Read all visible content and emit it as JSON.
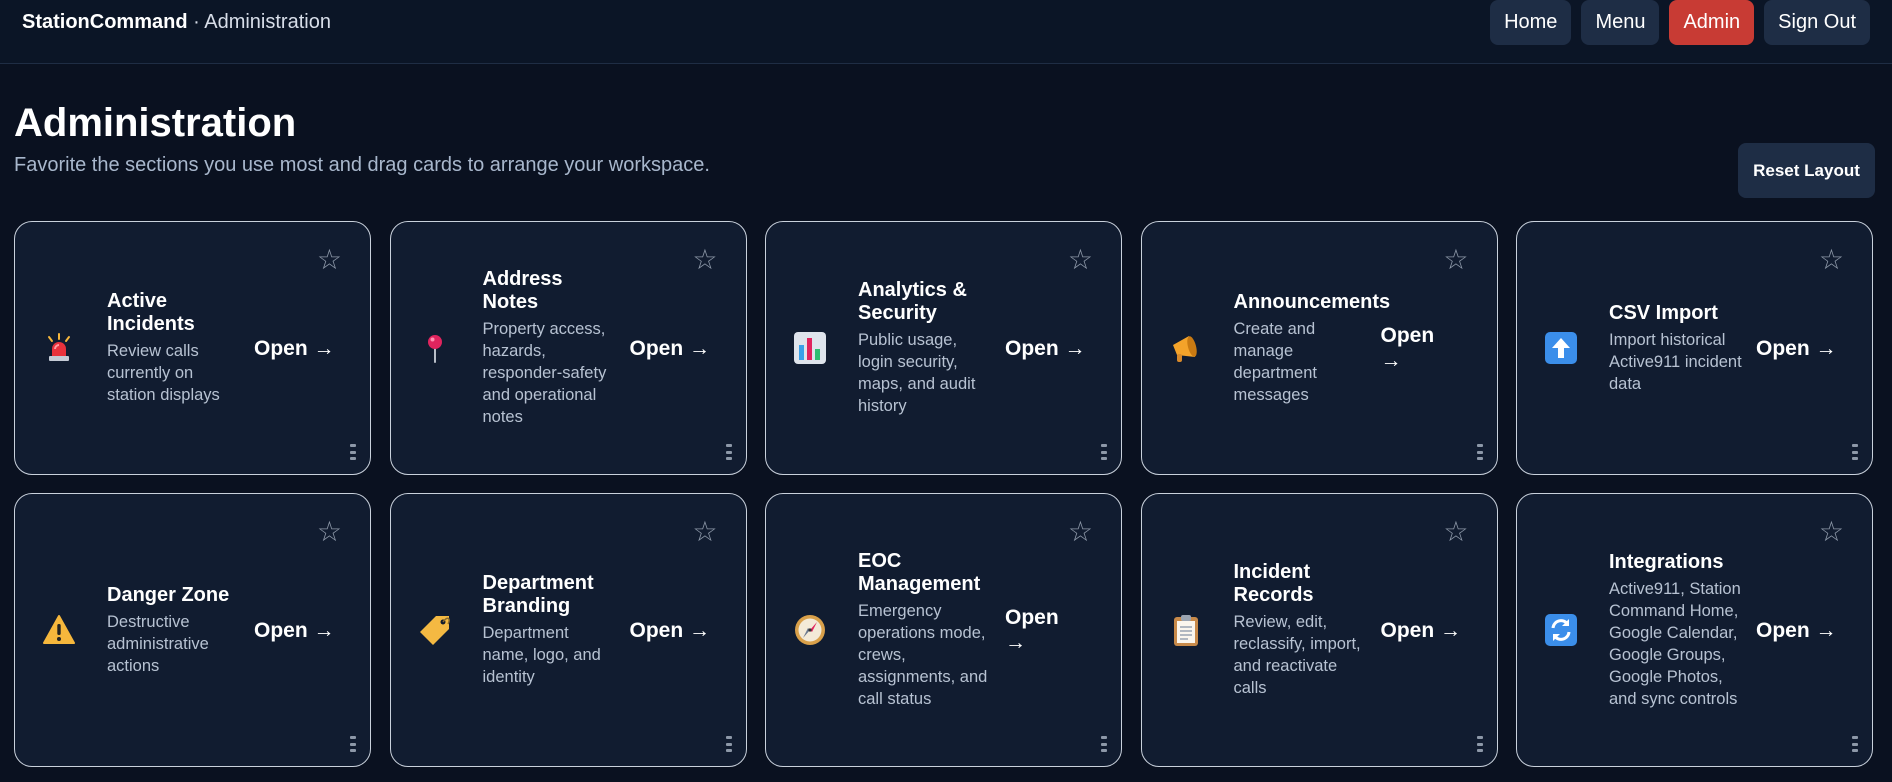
{
  "header": {
    "brand": "StationCommand",
    "section": " · Administration",
    "nav": [
      "Home",
      "Menu",
      "Admin",
      "Sign Out"
    ],
    "active_nav": "Admin"
  },
  "page": {
    "title": "Administration",
    "subtitle": "Favorite the sections you use most and drag cards to arrange your workspace.",
    "reset_label": "Reset Layout"
  },
  "cards": [
    {
      "title": "Active Incidents",
      "desc": "Review calls currently on station displays",
      "open": "Open →",
      "icon": "siren-icon"
    },
    {
      "title": "Address Notes",
      "desc": "Property access, hazards, responder-safety and operational notes",
      "open": "Open →",
      "icon": "pin-icon"
    },
    {
      "title": "Analytics & Security",
      "desc": "Public usage, login security, maps, and audit history",
      "open": "Open →",
      "icon": "chart-icon"
    },
    {
      "title": "Announcements",
      "desc": "Create and manage department messages",
      "open": "Open →",
      "icon": "megaphone-icon"
    },
    {
      "title": "CSV Import",
      "desc": "Import historical Active911 incident data",
      "open": "Open →",
      "icon": "upload-icon"
    },
    {
      "title": "Danger Zone",
      "desc": "Destructive administrative actions",
      "open": "Open →",
      "icon": "warning-icon"
    },
    {
      "title": "Department Branding",
      "desc": "Department name, logo, and identity",
      "open": "Open →",
      "icon": "tag-icon"
    },
    {
      "title": "EOC Management",
      "desc": "Emergency operations mode, crews, assignments, and call status",
      "open": "Open →",
      "icon": "compass-icon"
    },
    {
      "title": "Incident Records",
      "desc": "Review, edit, reclassify, import, and reactivate calls",
      "open": "Open →",
      "icon": "clipboard-icon"
    },
    {
      "title": "Integrations",
      "desc": "Active911, Station Command Home, Google Calendar, Google Groups, Google Photos, and sync controls",
      "open": "Open →",
      "icon": "sync-icon"
    }
  ],
  "colors": {
    "background": "#0a1120",
    "card": "#111c30",
    "admin_active": "#c83b34",
    "button": "#1e2d45"
  }
}
